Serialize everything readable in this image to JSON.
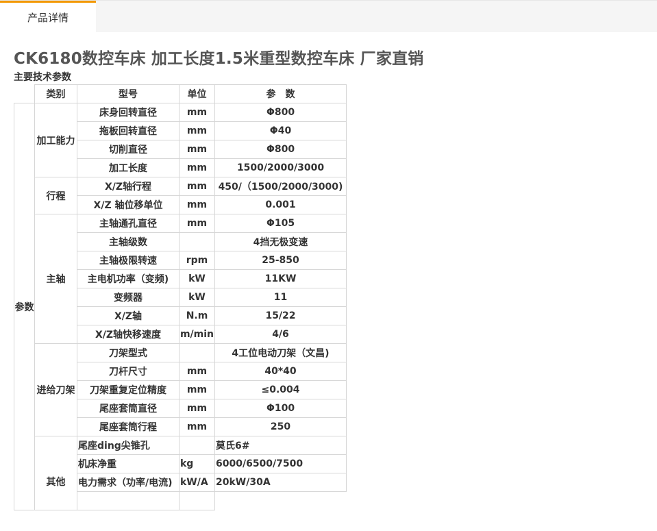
{
  "tabs": [
    {
      "label": "产品详情"
    }
  ],
  "product_title": "CK6180数控车床 加工长度1.5米重型数控车床 厂家直销",
  "section_title": "主要技术参数",
  "table": {
    "header": {
      "category": "类别",
      "model": "型号",
      "unit": "单位",
      "param": "参　数"
    },
    "left_label": "参数",
    "groups": {
      "processing": "加工能力",
      "travel": "行程",
      "spindle": "主轴",
      "feed": "进给刀架",
      "other": "其他"
    },
    "rows": [
      {
        "name": "床身回转直径",
        "unit": "mm",
        "value": "Φ800"
      },
      {
        "name": "拖板回转直径",
        "unit": "mm",
        "value": "Φ40"
      },
      {
        "name": "切削直径",
        "unit": "mm",
        "value": "Φ800"
      },
      {
        "name": "加工长度",
        "unit": "mm",
        "value": "1500/2000/3000"
      },
      {
        "name": "X/Z轴行程",
        "unit": "mm",
        "value": "450/（1500/2000/3000)"
      },
      {
        "name": "X/Z 轴位移单位",
        "unit": "mm",
        "value": "0.001"
      },
      {
        "name": "主轴通孔直径",
        "unit": "mm",
        "value": "Φ105"
      },
      {
        "name": "主轴级数",
        "unit": "",
        "value": "4挡无极变速"
      },
      {
        "name": "主轴极限转速",
        "unit": "rpm",
        "value": "25-850"
      },
      {
        "name": "主电机功率（变频)",
        "unit": "kW",
        "value": "11KW"
      },
      {
        "name": "变频器",
        "unit": "kW",
        "value": "11"
      },
      {
        "name": "X/Z轴",
        "unit": "N.m",
        "value": "15/22"
      },
      {
        "name": "X/Z轴快移速度",
        "unit": "m/min",
        "value": "4/6"
      },
      {
        "name": "刀架型式",
        "unit": "",
        "value": "4工位电动刀架（文昌)"
      },
      {
        "name": "刀杆尺寸",
        "unit": "mm",
        "value": "40*40"
      },
      {
        "name": "刀架重复定位精度",
        "unit": "mm",
        "value": "≤0.004"
      },
      {
        "name": "尾座套筒直径",
        "unit": "mm",
        "value": "Φ100"
      },
      {
        "name": "尾座套筒行程",
        "unit": "mm",
        "value": "250"
      },
      {
        "name": "尾座ding尖锥孔",
        "unit": "",
        "value": "莫氏6#"
      },
      {
        "name": "机床净重",
        "unit": "kg",
        "value": "6000/6500/7500"
      },
      {
        "name": "电力需求（功率/电流)",
        "unit": "kW/A",
        "value": "20kW/30A"
      }
    ]
  }
}
